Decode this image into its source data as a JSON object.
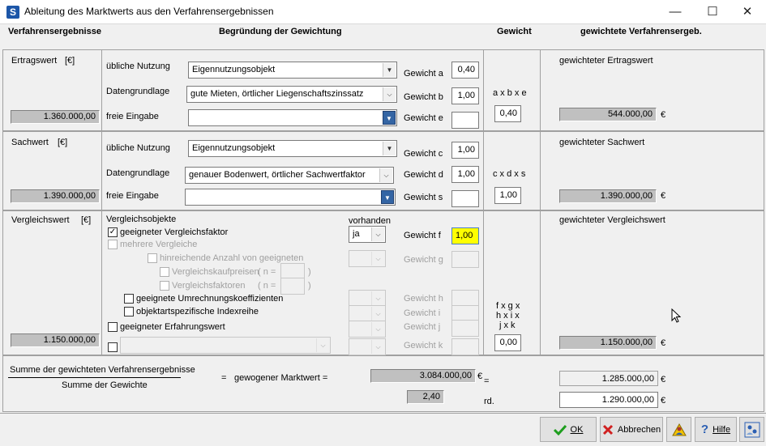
{
  "window": {
    "title": "Ableitung des Marktwerts aus den Verfahrensergebnissen",
    "app_icon": "S",
    "minimize": "—",
    "maximize": "☐",
    "close": "✕"
  },
  "headers": {
    "verfahrensergebnisse": "Verfahrensergebnisse",
    "begruendung": "Begründung der Gewichtung",
    "gewicht": "Gewicht",
    "gewichtete": "gewichtete Verfahrensergeb."
  },
  "ertrag": {
    "label": "Ertragswert",
    "unit": "[€]",
    "value": "1.360.000,00",
    "nutzung_label": "übliche Nutzung",
    "nutzung_value": "Eigennutzungsobjekt",
    "daten_label": "Datengrundlage",
    "daten_value": "gute Mieten, örtlicher Liegenschaftszinssatz",
    "frei_label": "freie Eingabe",
    "frei_value": "",
    "gewicht_a_label": "Gewicht a",
    "gewicht_a": "0,40",
    "gewicht_b_label": "Gewicht b",
    "gewicht_b": "1,00",
    "gewicht_e_label": "Gewicht e",
    "gewicht_e": "",
    "formula": "a x b x e",
    "product": "0,40",
    "weighted_label": "gewichteter Ertragswert",
    "weighted_value": "544.000,00",
    "currency": "€"
  },
  "sach": {
    "label": "Sachwert",
    "unit": "[€]",
    "value": "1.390.000,00",
    "nutzung_label": "übliche Nutzung",
    "nutzung_value": "Eigennutzungsobjekt",
    "daten_label": "Datengrundlage",
    "daten_value": "genauer Bodenwert, örtlicher Sachwertfaktor",
    "frei_label": "freie Eingabe",
    "frei_value": "",
    "gewicht_c_label": "Gewicht c",
    "gewicht_c": "1,00",
    "gewicht_d_label": "Gewicht d",
    "gewicht_d": "1,00",
    "gewicht_s_label": "Gewicht s",
    "gewicht_s": "",
    "formula": "c x d x s",
    "product": "1,00",
    "weighted_label": "gewichteter Sachwert",
    "weighted_value": "1.390.000,00",
    "currency": "€"
  },
  "vergleich": {
    "label": "Vergleichswert",
    "unit": "[€]",
    "value": "1.150.000,00",
    "objekte_label": "Vergleichsobjekte",
    "vorhanden_label": "vorhanden",
    "vorhanden_value": "ja",
    "faktor_label": "geeigneter Vergleichsfaktor",
    "faktor_checked": "✓",
    "mehrere_label": "mehrere Vergleiche",
    "hinreichend_label": "hinreichende Anzahl von geeigneten",
    "kaufpreise_label": "Vergleichskaufpreisen",
    "faktoren_label": "Vergleichsfaktoren",
    "n_label": "( n =",
    "n_close": ")",
    "umrechnung_label": "geeignete Umrechnungskoeffizienten",
    "index_label": "objektartspezifische Indexreihe",
    "erfahrung_label": "geeigneter Erfahrungswert",
    "gewicht_f_label": "Gewicht f",
    "gewicht_f": "1,00",
    "gewicht_g_label": "Gewicht g",
    "gewicht_h_label": "Gewicht h",
    "gewicht_i_label": "Gewicht i",
    "gewicht_j_label": "Gewicht j",
    "gewicht_k_label": "Gewicht k",
    "formula_1": "f x g x",
    "formula_2": "h x i x",
    "formula_3": "j x k",
    "product": "0,00",
    "weighted_label": "gewichteter Vergleichswert",
    "weighted_value": "1.150.000,00",
    "currency": "€"
  },
  "summary": {
    "numerator": "Summe der gewichteten Verfahrensergebnisse",
    "denominator": "Summe der Gewichte",
    "eq": "=",
    "gewogen_label": "gewogener Marktwert =",
    "sum_weighted": "3.084.000,00",
    "sum_currency": "€",
    "sum_weights": "2,40",
    "eq2": "=",
    "marktwert": "1.285.000,00",
    "rd_label": "rd.",
    "rounded": "1.290.000,00",
    "currency": "€"
  },
  "buttons": {
    "ok": "OK",
    "abbrechen": "Abbrechen",
    "hilfe": "Hilfe"
  },
  "colors": {
    "highlight": "#ffff00",
    "ok_check": "#1e9e1e",
    "cancel_x": "#d02020",
    "help_blue": "#2b5fb3"
  }
}
